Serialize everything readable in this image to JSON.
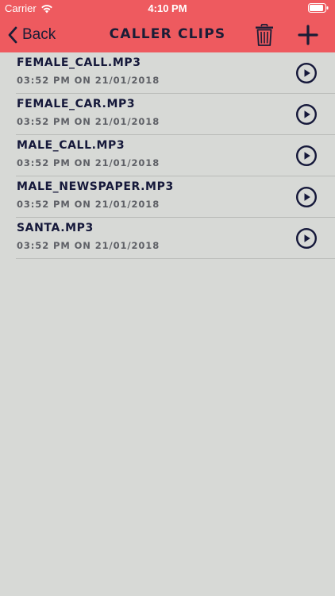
{
  "status_bar": {
    "carrier": "Carrier",
    "time": "4:10 PM"
  },
  "nav": {
    "back_label": "Back",
    "title": "Caller Clips"
  },
  "clips": [
    {
      "name": "FEMALE_CALL.MP3",
      "meta": "03:52 PM ON 21/01/2018"
    },
    {
      "name": "FEMALE_CAR.MP3",
      "meta": "03:52 PM ON 21/01/2018"
    },
    {
      "name": "MALE_CALL.MP3",
      "meta": "03:52 PM ON 21/01/2018"
    },
    {
      "name": "MALE_NEWSPAPER.MP3",
      "meta": "03:52 PM ON 21/01/2018"
    },
    {
      "name": "SANTA.MP3",
      "meta": "03:52 PM ON 21/01/2018"
    }
  ],
  "colors": {
    "accent": "#ee5a5f",
    "background": "#d7d9d6",
    "text_dark": "#15183a",
    "text_meta": "#5e6066"
  },
  "icons": {
    "back": "chevron-left-icon",
    "trash": "trash-icon",
    "add": "plus-icon",
    "play": "play-circle-icon",
    "wifi": "wifi-icon",
    "battery": "battery-icon"
  }
}
